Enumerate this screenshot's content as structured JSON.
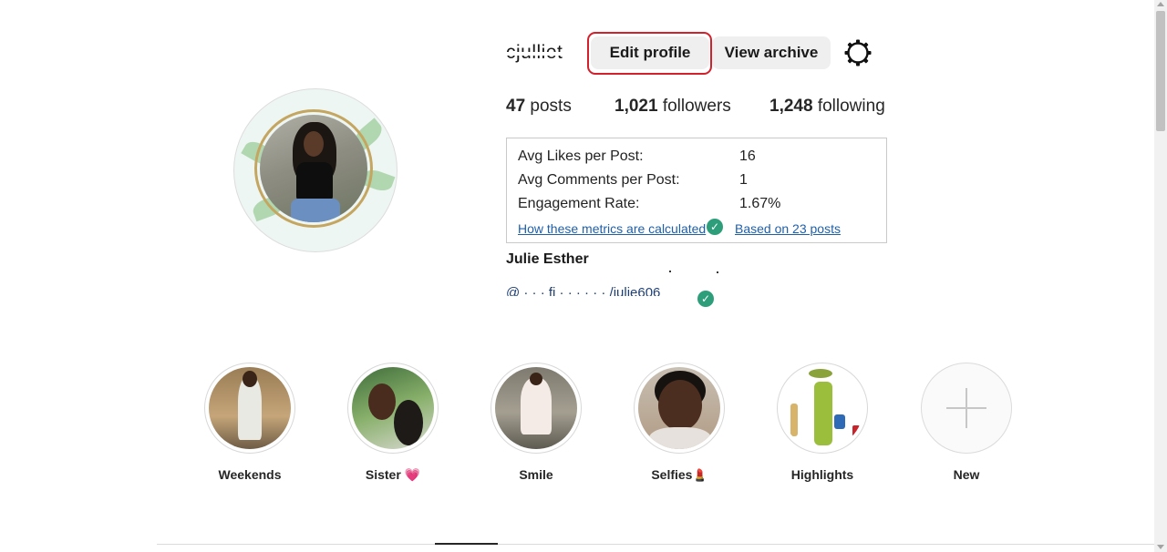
{
  "profile": {
    "username": "cjulliet",
    "edit_profile_label": "Edit profile",
    "view_archive_label": "View archive",
    "full_name": "Julie Esther",
    "bio_link": "@ · · · fi · · · · · · /julie606"
  },
  "stats": {
    "posts_count": "47",
    "posts_label": "posts",
    "followers_count": "1,021",
    "followers_label": "followers",
    "following_count": "1,248",
    "following_label": "following"
  },
  "metrics": {
    "avg_likes_label": "Avg Likes per Post:",
    "avg_likes_value": "16",
    "avg_comments_label": "Avg Comments per Post:",
    "avg_comments_value": "1",
    "engagement_label": "Engagement Rate:",
    "engagement_value": "1.67%",
    "how_link": "How these metrics are calculated",
    "based_link": "Based on 23 posts"
  },
  "highlights": [
    {
      "label": "Weekends",
      "emoji": ""
    },
    {
      "label": "Sister",
      "emoji": "💗"
    },
    {
      "label": "Smile",
      "emoji": ""
    },
    {
      "label": "Selfies",
      "emoji": "💄"
    },
    {
      "label": "Highlights",
      "emoji": ""
    },
    {
      "label": "New",
      "emoji": ""
    }
  ],
  "colors": {
    "highlight_ring": "#d2202c",
    "link": "#1f5fa8",
    "check_badge": "#2e9e7a",
    "button_bg": "#efefef"
  },
  "icons": {
    "settings": "gear-icon",
    "verified": "check-circle-icon",
    "new_highlight": "plus-icon"
  }
}
